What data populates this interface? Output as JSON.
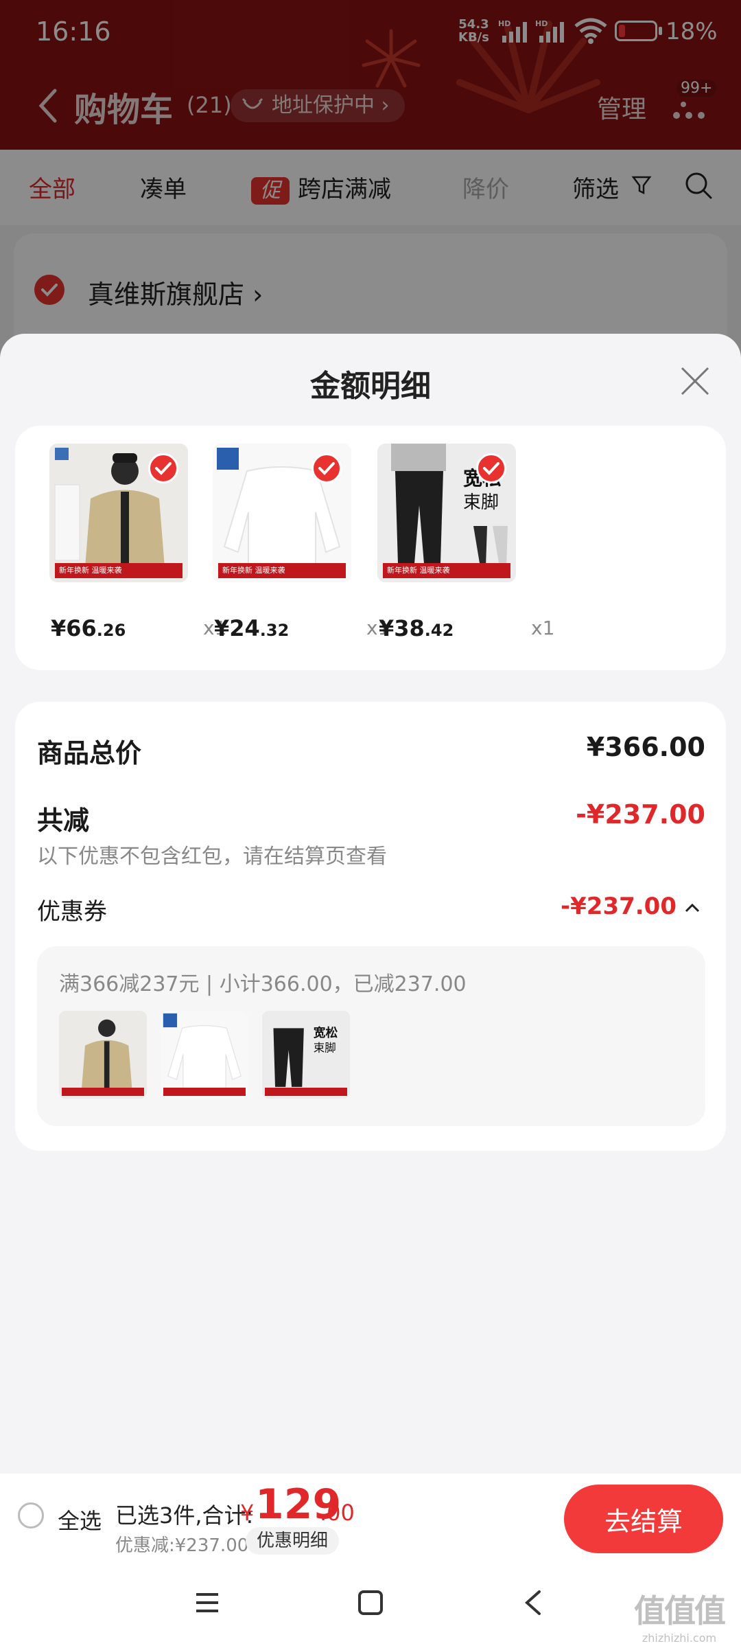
{
  "status_bar": {
    "time": "16:16",
    "net_speed": "54.3",
    "net_unit": "KB/s",
    "hd1": "HD",
    "hd2": "HD",
    "battery": "18%",
    "battery_level": 0.18
  },
  "header": {
    "title": "购物车",
    "count": "(21)",
    "address_protect": "地址保护中 ›",
    "manage": "管理",
    "more_badge": "99+"
  },
  "filters": {
    "tabs": [
      "全部",
      "凑单",
      "跨店满减",
      "降价",
      "筛选"
    ],
    "promo_tag": "促"
  },
  "store": {
    "name": "真维斯旗舰店 ›"
  },
  "sheet": {
    "title": "金额明细",
    "products": [
      {
        "price_int": "¥66",
        "price_dec": ".26",
        "qty": "x1",
        "banner": "新年换新 温暖来袭"
      },
      {
        "price_int": "¥24",
        "price_dec": ".32",
        "qty": "x1",
        "banner": "新年换新 温暖来袭"
      },
      {
        "price_int": "¥38",
        "price_dec": ".42",
        "qty": "x1",
        "banner": "新年换新 温暖来袭"
      }
    ],
    "product_image_text": {
      "pants_line1": "宽松",
      "pants_line2": "束脚"
    },
    "summary": {
      "total_label": "商品总价",
      "total_value": "¥366.00",
      "reduce_label": "共减",
      "reduce_value": "-¥237.00",
      "reduce_note": "以下优惠不包含红包，请在结算页查看",
      "coupon_label": "优惠券",
      "coupon_value": "-¥237.00",
      "coupon_rule": "满366减237元 | 小计366.00，已减237.00"
    }
  },
  "checkout": {
    "select_all": "全选",
    "selected": "已选3件,合计:",
    "currency": "¥",
    "total_int": "129",
    "total_dec": ".00",
    "discount": "优惠减:¥237.00",
    "detail_chip": "优惠明细",
    "button": "去结算"
  },
  "watermark": {
    "logo": "值值值",
    "url": "zhizhizhi.com"
  },
  "colors": {
    "header": "#8a1212",
    "accent": "#e0282b",
    "button": "#f23a3a"
  }
}
